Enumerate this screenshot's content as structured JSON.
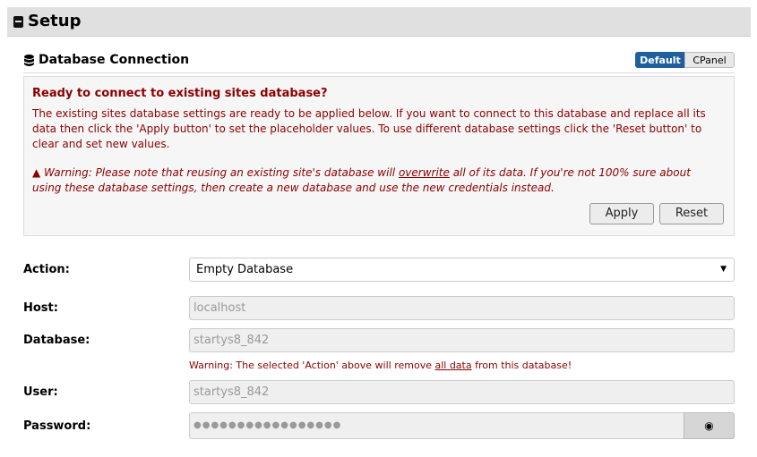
{
  "header": {
    "title": "Setup",
    "icon": "minus-square-icon"
  },
  "section": {
    "title": "Database Connection",
    "icon": "database-icon",
    "toggle": [
      {
        "label": "Default",
        "active": true
      },
      {
        "label": "CPanel",
        "active": false
      }
    ]
  },
  "notice": {
    "heading": "Ready to connect to existing sites database?",
    "body": "The existing sites database settings are ready to be applied below. If you want to connect to this database and replace all its data then click the 'Apply button' to set the placeholder values. To use different database settings click the 'Reset button' to clear and set new values.",
    "warning_pre": "Warning: Please note that reusing an existing site's database will ",
    "warning_emph": "overwrite",
    "warning_post": " all of its data. If you're not 100% sure about using these database settings, then create a new database and use the new credentials instead.",
    "apply": "Apply",
    "reset": "Reset",
    "colors": {
      "text": "#8b0000"
    }
  },
  "form": {
    "action": {
      "label": "Action:",
      "value": "Empty Database"
    },
    "host": {
      "label": "Host:",
      "value": "localhost"
    },
    "database": {
      "label": "Database:",
      "value": "startys8_842"
    },
    "db_warning": {
      "pre": "Warning: The selected 'Action' above will remove ",
      "emph": "all data",
      "post": " from this database!"
    },
    "user": {
      "label": "User:",
      "value": "startys8_842"
    },
    "password": {
      "label": "Password:",
      "value": "●●●●●●●●●●●●●●●●●",
      "toggle_icon": "eye-icon"
    }
  }
}
